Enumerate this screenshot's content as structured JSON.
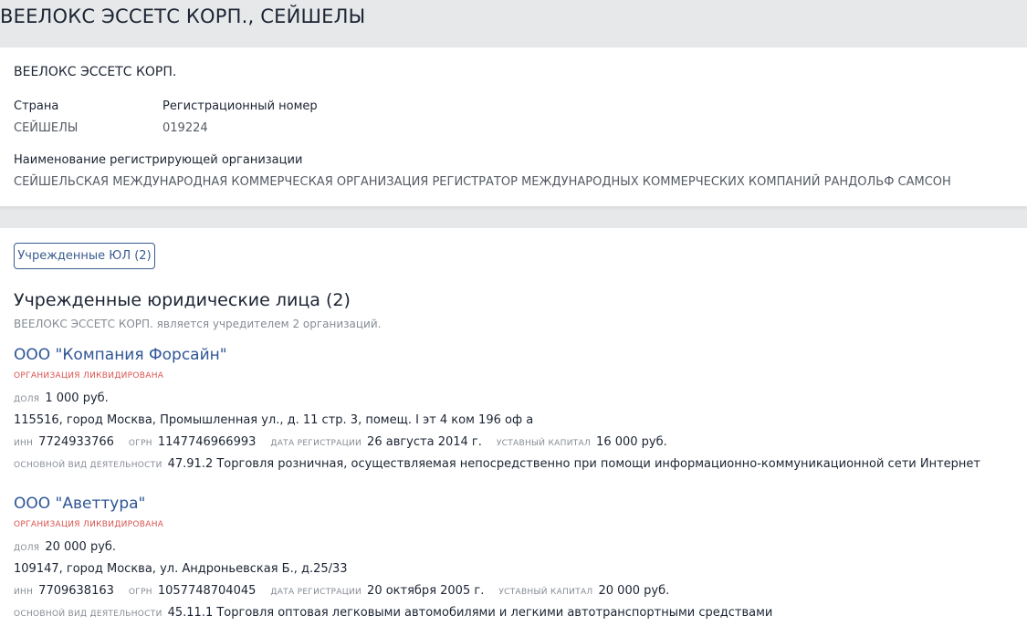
{
  "header": {
    "title": "ВЕЕЛОКС ЭССЕТС КОРП., СЕЙШЕЛЫ"
  },
  "card": {
    "short_name": "ВЕЕЛОКС ЭССЕТС КОРП.",
    "country_label": "Страна",
    "country_value": "СЕЙШЕЛЫ",
    "regnum_label": "Регистрационный номер",
    "regnum_value": "019224",
    "registrar_label": "Наименование регистрирующей организации",
    "registrar_value": "СЕЙШЕЛЬСКАЯ МЕЖДУНАРОДНАЯ КОММЕРЧЕСКАЯ ОРГАНИЗАЦИЯ РЕГИСТРАТОР МЕЖДУНАРОДНЫХ КОММЕРЧЕСКИХ КОМПАНИЙ РАНДОЛЬФ САМСОН"
  },
  "tab": {
    "label": "Учрежденные ЮЛ (2)"
  },
  "section": {
    "title": "Учрежденные юридические лица (2)",
    "subtitle": "ВЕЕЛОКС ЭССЕТС КОРП. является учредителем 2 организаций."
  },
  "labels": {
    "share": "ДОЛЯ",
    "inn": "ИНН",
    "ogrn": "ОГРН",
    "reg_date": "ДАТА РЕГИСТРАЦИИ",
    "capital": "УСТАВНЫЙ КАПИТАЛ",
    "activity": "ОСНОВНОЙ ВИД ДЕЯТЕЛЬНОСТИ"
  },
  "companies": [
    {
      "name": "ООО \"Компания Форсайн\"",
      "status": "ОРГАНИЗАЦИЯ ЛИКВИДИРОВАНА",
      "share": "1 000 руб.",
      "address": "115516, город Москва, Промышленная ул., д. 11 стр. 3, помещ. I эт 4 ком 196 оф а",
      "inn": "7724933766",
      "ogrn": "1147746966993",
      "reg_date": "26 августа 2014 г.",
      "capital": "16 000 руб.",
      "activity": "47.91.2 Торговля розничная, осуществляемая непосредственно при помощи информационно-коммуникационной сети Интернет"
    },
    {
      "name": "ООО \"Аветтура\"",
      "status": "ОРГАНИЗАЦИЯ ЛИКВИДИРОВАНА",
      "share": "20 000 руб.",
      "address": "109147, город Москва, ул. Андроньевская Б., д.25/33",
      "inn": "7709638163",
      "ogrn": "1057748704045",
      "reg_date": "20 октября 2005 г.",
      "capital": "20 000 руб.",
      "activity": "45.11.1 Торговля оптовая легковыми автомобилями и легкими автотранспортными средствами"
    }
  ],
  "colors": {
    "link": "#2f5596",
    "status": "#d9534f",
    "background": "#e6e8ea"
  }
}
